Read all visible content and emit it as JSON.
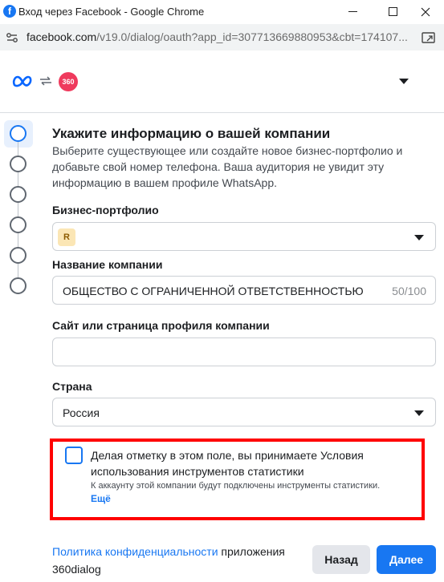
{
  "window": {
    "title": "Вход через Facebook - Google Chrome",
    "url_host": "facebook.com",
    "url_path": "/v19.0/dialog/oauth?app_id=307713669880953&cbt=174107..."
  },
  "header": {
    "logos": [
      "meta-logo",
      "swap-icon",
      "360dialog-logo"
    ],
    "brand_badge": "360"
  },
  "steps": {
    "count": 6,
    "active_index": 0
  },
  "form": {
    "heading": "Укажите информацию о вашей компании",
    "subtext": "Выберите существующее или создайте новое бизнес-портфолио и добавьте свой номер телефона. Ваша аудитория не увидит эту информацию в вашем профиле WhatsApp.",
    "portfolio": {
      "label": "Бизнес-портфолио",
      "badge": "R",
      "value": ""
    },
    "company_name": {
      "label": "Название компании",
      "value": "ОБЩЕСТВО С ОГРАНИЧЕННОЙ ОТВЕТСТВЕННОСТЬЮ",
      "counter": "50/100"
    },
    "website": {
      "label": "Сайт или страница профиля компании",
      "value": ""
    },
    "country": {
      "label": "Страна",
      "value": "Россия"
    },
    "consent": {
      "checked": false,
      "text": "Делая отметку в этом поле, вы принимаете Условия использования инструментов статистики",
      "subtext": "К аккаунту этой компании будут подключены инструменты статистики.",
      "more_link": "Ещё"
    }
  },
  "footer": {
    "privacy_link": "Политика конфиденциальности",
    "privacy_suffix": " приложения 360dialog",
    "back_label": "Назад",
    "next_label": "Далее"
  },
  "colors": {
    "accent": "#1877f2",
    "highlight_border": "#ff0000",
    "brand_360": "#ef3a5d"
  }
}
